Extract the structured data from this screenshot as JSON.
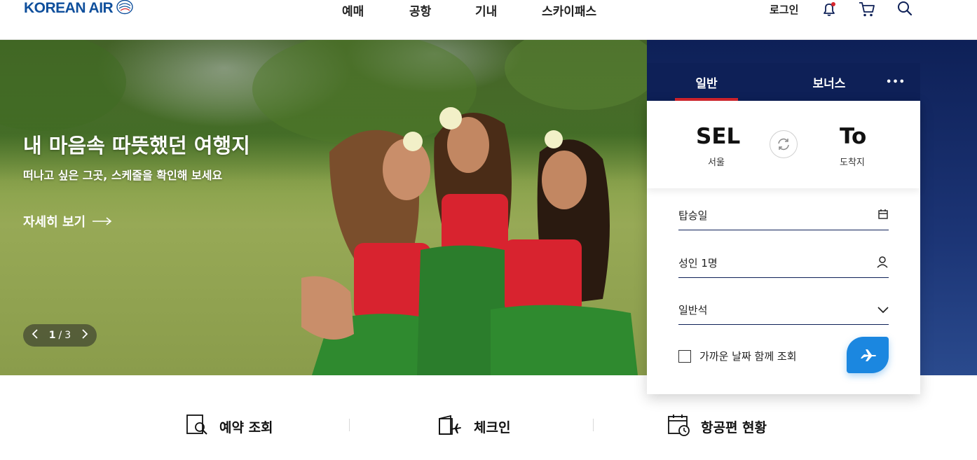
{
  "brand": {
    "name": "KOREAN AIR",
    "color": "#0f4f9c",
    "accent": "#d7262e"
  },
  "nav": {
    "items": [
      {
        "label": "예매"
      },
      {
        "label": "공항"
      },
      {
        "label": "기내"
      },
      {
        "label": "스카이패스"
      }
    ],
    "login_label": "로그인",
    "icons": [
      "bell-icon",
      "cart-icon",
      "search-icon"
    ]
  },
  "hero": {
    "title": "내 마음속 따뜻했던 여행지",
    "subtitle": "떠나고 싶은 그곳, 스케줄을 확인해 보세요",
    "more_label": "자세히 보기",
    "pager": {
      "current": "1",
      "separator": "/",
      "total": "3"
    }
  },
  "booking": {
    "tabs": [
      {
        "label": "일반",
        "active": true
      },
      {
        "label": "보너스",
        "active": false
      },
      {
        "label": "•••",
        "active": false
      }
    ],
    "origin": {
      "code": "SEL",
      "name": "서울"
    },
    "destination": {
      "code": "To",
      "name": "도착지"
    },
    "fields": {
      "date": {
        "label": "탑승일",
        "icon": "calendar-icon"
      },
      "passengers": {
        "label": "성인 1명",
        "icon": "person-icon"
      },
      "cabin": {
        "label": "일반석",
        "icon": "chevron-down-icon"
      }
    },
    "nearby_label": "가까운 날짜 함께 조회",
    "search_icon": "airplane-icon"
  },
  "quick_menu": [
    {
      "label": "예약 조회",
      "icon": "reservation-search-icon"
    },
    {
      "label": "체크인",
      "icon": "checkin-icon"
    },
    {
      "label": "항공편 현황",
      "icon": "flight-status-icon"
    }
  ]
}
